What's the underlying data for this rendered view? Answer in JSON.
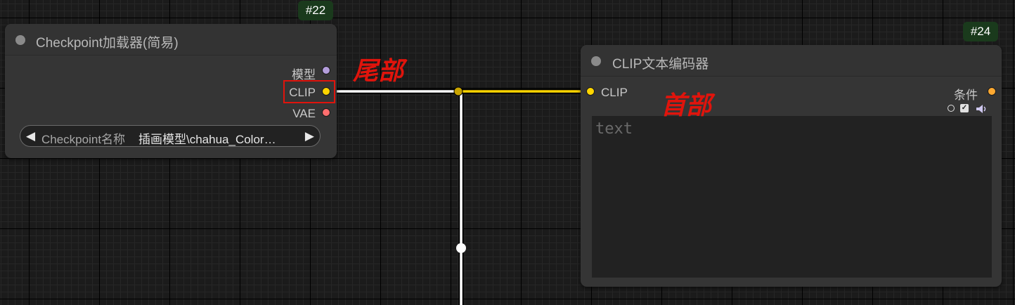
{
  "colors": {
    "clip": "#ffd500",
    "model": "#b39ddb",
    "vae": "#ff6e6e",
    "conditioning": "#ffa931",
    "annotation": "#e0140c",
    "badge_bg": "#1a3a1c"
  },
  "node_checkpoint": {
    "badge": "#22",
    "title": "Checkpoint加载器(简易)",
    "outputs": {
      "model": "模型",
      "clip": "CLIP",
      "vae": "VAE"
    },
    "widget": {
      "label": "Checkpoint名称",
      "value": "插画模型\\chahua_Color…",
      "left_arrow": "◀",
      "right_arrow": "▶"
    }
  },
  "node_clip_encoder": {
    "badge": "#24",
    "title": "CLIP文本编码器",
    "input_clip": "CLIP",
    "output_conditioning": "条件",
    "text_placeholder": "text"
  },
  "annotations": {
    "tail": "尾部",
    "head": "首部"
  },
  "icons": [
    "circle-toggle-icon",
    "checkbox-icon",
    "speaker-icon"
  ]
}
